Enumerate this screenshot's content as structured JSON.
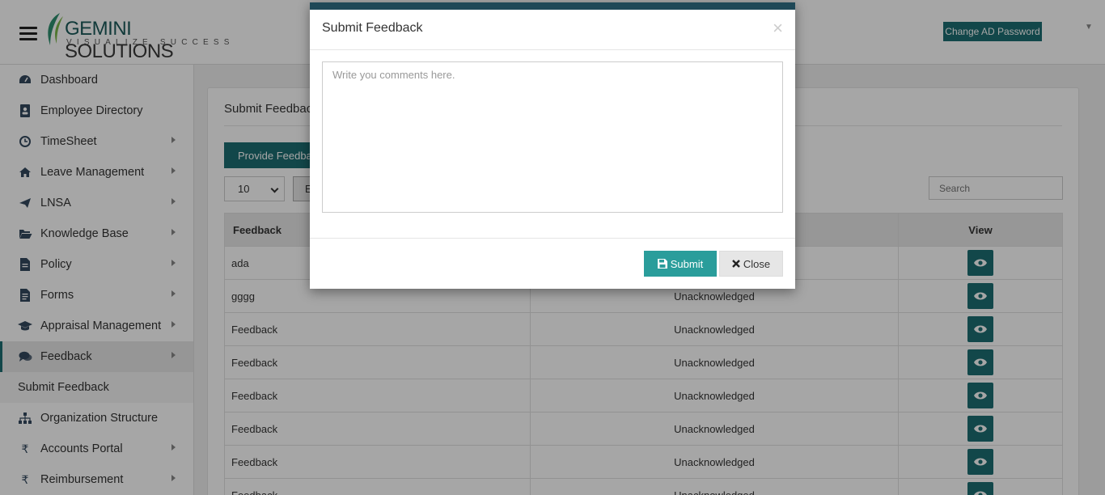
{
  "header": {
    "logo_main_prefix": "GEMINI",
    "logo_main_suffix": " SOLUTIONS",
    "logo_tagline": "VISUALIZE SUCCESS",
    "change_password_label": "Change AD Password"
  },
  "sidebar": {
    "items": [
      {
        "label": "Dashboard",
        "icon": "dashboard-icon",
        "has_arrow": false
      },
      {
        "label": "Employee Directory",
        "icon": "address-book-icon",
        "has_arrow": false
      },
      {
        "label": "TimeSheet",
        "icon": "clock-icon",
        "has_arrow": true
      },
      {
        "label": "Leave Management",
        "icon": "home-icon",
        "has_arrow": true
      },
      {
        "label": "LNSA",
        "icon": "send-icon",
        "has_arrow": true
      },
      {
        "label": "Knowledge Base",
        "icon": "folder-open-icon",
        "has_arrow": true
      },
      {
        "label": "Policy",
        "icon": "document-icon",
        "has_arrow": true
      },
      {
        "label": "Forms",
        "icon": "form-icon",
        "has_arrow": true
      },
      {
        "label": "Appraisal Management",
        "icon": "graduation-cap-icon",
        "has_arrow": true
      },
      {
        "label": "Feedback",
        "icon": "comments-icon",
        "has_arrow": true
      },
      {
        "label": "Organization Structure",
        "icon": "sitemap-icon",
        "has_arrow": false
      },
      {
        "label": "Accounts Portal",
        "icon": "rupee-icon",
        "has_arrow": true
      },
      {
        "label": "Reimbursement",
        "icon": "rupee-icon",
        "has_arrow": true
      }
    ],
    "sub_item": "Submit Feedback"
  },
  "main": {
    "card_title": "Submit Feedback",
    "provide_button": "Provide Feedback",
    "page_length": "10",
    "export_label": "E",
    "search_placeholder": "Search",
    "columns": [
      "Feedback",
      "",
      "View"
    ],
    "rows": [
      {
        "feedback": "ada",
        "status": ""
      },
      {
        "feedback": "gggg",
        "status": "Unacknowledged"
      },
      {
        "feedback": "Feedback",
        "status": "Unacknowledged"
      },
      {
        "feedback": "Feedback",
        "status": "Unacknowledged"
      },
      {
        "feedback": "Feedback",
        "status": "Unacknowledged"
      },
      {
        "feedback": "Feedback",
        "status": "Unacknowledged"
      },
      {
        "feedback": "Feedback",
        "status": "Unacknowledged"
      },
      {
        "feedback": "Feedback",
        "status": "Unacknowledged"
      }
    ]
  },
  "modal": {
    "title": "Submit Feedback",
    "close_x": "×",
    "textarea_placeholder": "Write you comments here.",
    "submit_label": "Submit",
    "close_label": "Close"
  },
  "colors": {
    "brand_teal": "#1d6e72",
    "submit_teal": "#2a9d9b",
    "modal_top_bar": "#1f4857"
  }
}
